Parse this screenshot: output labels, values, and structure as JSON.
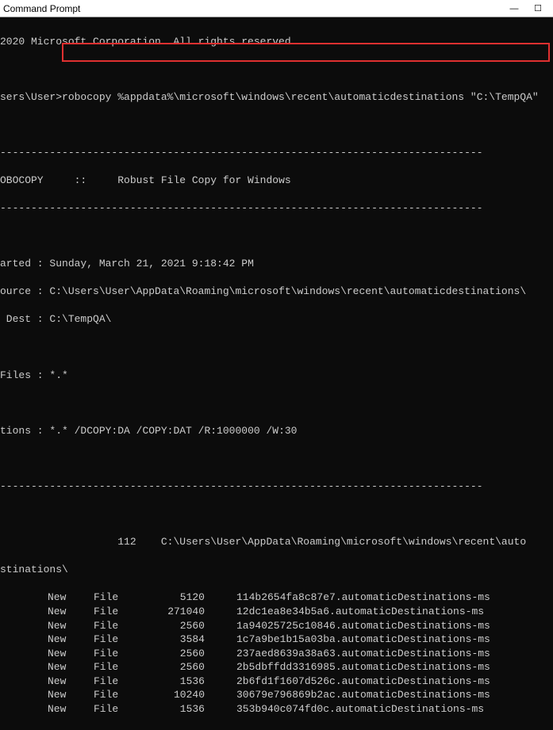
{
  "window": {
    "title": "Command Prompt",
    "minimize": "—",
    "maximize": "☐"
  },
  "copyright": "2020 Microsoft Corporation. All rights reserved.",
  "prompt_prefix": "sers\\User>",
  "command": "robocopy %appdata%\\microsoft\\windows\\recent\\automaticdestinations \"C:\\TempQA\"",
  "robocopy_label": "OBOCOPY     ::",
  "robocopy_desc": "Robust File Copy for Windows",
  "started_label": "arted : ",
  "started_value": "Sunday, March 21, 2021 9:18:42 PM",
  "source_label": "ource : ",
  "source_value": "C:\\Users\\User\\AppData\\Roaming\\microsoft\\windows\\recent\\automaticdestinations\\",
  "dest_label": " Dest : ",
  "dest_value": "C:\\TempQA\\",
  "files_label": "Files : ",
  "files_value": "*.*",
  "options_label": "tions : ",
  "options_value": "*.* /DCOPY:DA /COPY:DAT /R:1000000 /W:30",
  "dir_count": "112",
  "dir_path": "C:\\Users\\User\\AppData\\Roaming\\microsoft\\windows\\recent\\auto",
  "dir_path_cont": "stinations\\",
  "divider": "------------------------------------------------------------------------------",
  "files": [
    {
      "new": "New",
      "file": "File",
      "size": "5120",
      "name": "114b2654fa8c87e7.automaticDestinations-ms"
    },
    {
      "new": "New",
      "file": "File",
      "size": "271040",
      "name": "12dc1ea8e34b5a6.automaticDestinations-ms"
    },
    {
      "new": "New",
      "file": "File",
      "size": "2560",
      "name": "1a94025725c10846.automaticDestinations-ms"
    },
    {
      "new": "New",
      "file": "File",
      "size": "3584",
      "name": "1c7a9be1b15a03ba.automaticDestinations-ms"
    },
    {
      "new": "New",
      "file": "File",
      "size": "2560",
      "name": "237aed8639a38a63.automaticDestinations-ms"
    },
    {
      "new": "New",
      "file": "File",
      "size": "2560",
      "name": "2b5dbffdd3316985.automaticDestinations-ms"
    },
    {
      "new": "New",
      "file": "File",
      "size": "1536",
      "name": "2b6fd1f1607d526c.automaticDestinations-ms"
    },
    {
      "new": "New",
      "file": "File",
      "size": "10240",
      "name": "30679e796869b2ac.automaticDestinations-ms"
    },
    {
      "new": "New",
      "file": "File",
      "size": "1536",
      "name": "353b940c074fd0c.automaticDestinations-ms"
    }
  ]
}
